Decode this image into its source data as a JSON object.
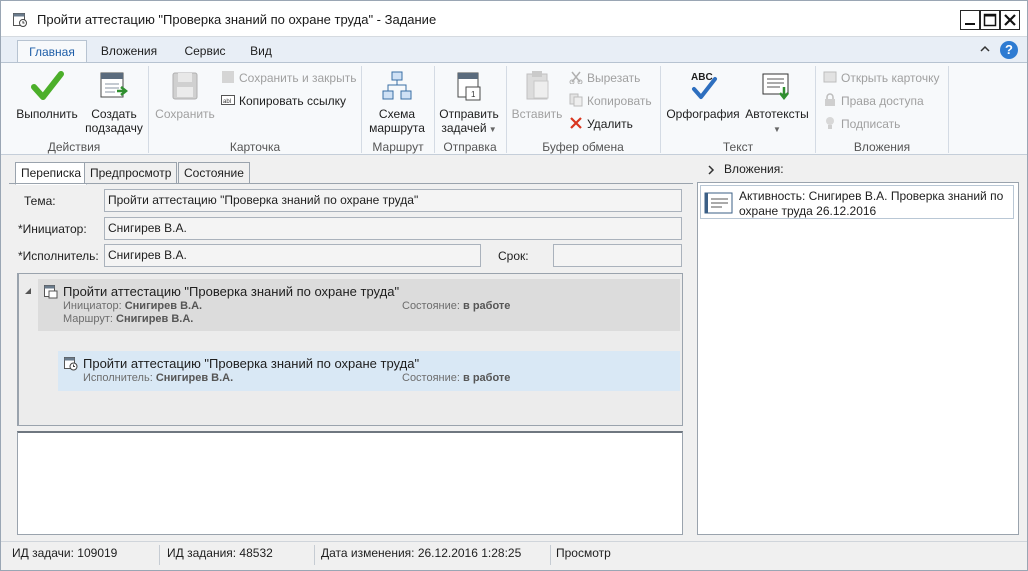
{
  "window": {
    "title": "Пройти аттестацию \"Проверка знаний по охране труда\" - Задание"
  },
  "ribbon_tabs": [
    "Главная",
    "Вложения",
    "Сервис",
    "Вид"
  ],
  "ribbon": {
    "actions": {
      "label": "Действия",
      "complete": "Выполнить",
      "create_subtask_1": "Создать",
      "create_subtask_2": "подзадачу"
    },
    "card": {
      "label": "Карточка",
      "save": "Сохранить",
      "save_close": "Сохранить и закрыть",
      "copy_link": "Копировать ссылку"
    },
    "route": {
      "label": "Маршрут",
      "scheme_1": "Схема",
      "scheme_2": "маршрута"
    },
    "send": {
      "label": "Отправка",
      "send_1": "Отправить",
      "send_2": "задачей"
    },
    "clipboard": {
      "label": "Буфер обмена",
      "paste": "Вставить",
      "cut": "Вырезать",
      "copy": "Копировать",
      "delete": "Удалить"
    },
    "text": {
      "label": "Текст",
      "spelling": "Орфография",
      "autotext": "Автотексты",
      "abc": "ABC"
    },
    "attachments": {
      "label": "Вложения",
      "open_card": "Открыть карточку",
      "access_rights": "Права доступа",
      "sign": "Подписать"
    }
  },
  "content_tabs": [
    "Переписка",
    "Предпросмотр",
    "Состояние"
  ],
  "form": {
    "subject_label": "Тема:",
    "subject_value": "Пройти аттестацию \"Проверка знаний по охране труда\"",
    "initiator_label": "*Инициатор:",
    "initiator_value": "Снигирев В.А.",
    "executor_label": "*Исполнитель:",
    "executor_value": "Снигирев В.А.",
    "deadline_label": "Срок:",
    "deadline_value": ""
  },
  "tree": {
    "parent": {
      "title": "Пройти аттестацию \"Проверка знаний по охране труда\"",
      "initiator_label": "Инициатор:",
      "initiator_value": "Снигирев В.А.",
      "route_label": "Маршрут:",
      "route_value": "Снигирев В.А.",
      "state_label": "Состояние:",
      "state_value": "в работе"
    },
    "child": {
      "title": "Пройти аттестацию \"Проверка знаний по охране труда\"",
      "executor_label": "Исполнитель:",
      "executor_value": "Снигирев В.А.",
      "state_label": "Состояние:",
      "state_value": "в работе"
    }
  },
  "attachments_panel": {
    "header": "Вложения:",
    "item_text": "Активность: Снигирев В.А. Проверка знаний по охране труда 26.12.2016"
  },
  "statusbar": {
    "task_id": "ИД задачи: 109019",
    "assignment_id": "ИД задания: 48532",
    "modified": "Дата изменения: 26.12.2016 1:28:25",
    "mode": "Просмотр"
  },
  "colors": {
    "accent": "#1e5ea8",
    "selected_row": "#d9e8f5",
    "parent_row": "#dcdcdc",
    "check_green": "#4caf2a"
  }
}
